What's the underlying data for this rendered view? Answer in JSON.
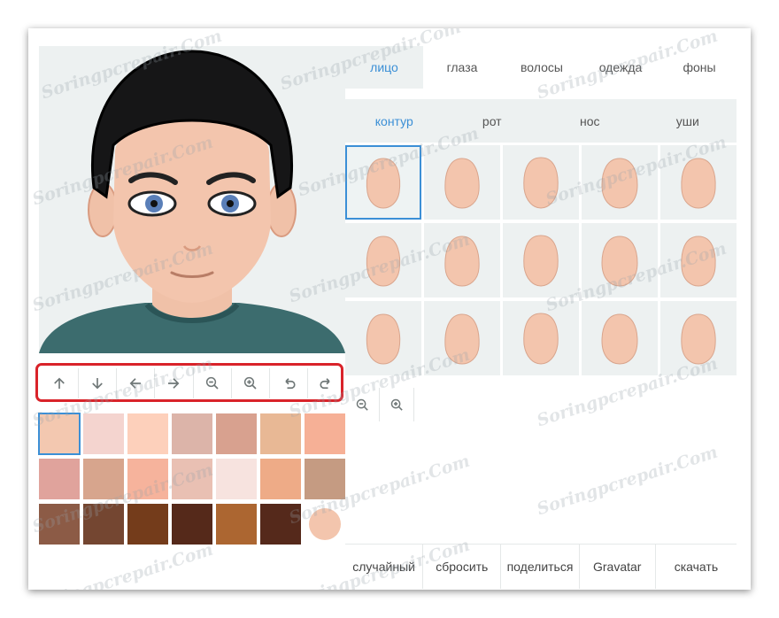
{
  "tabs": [
    {
      "label": "лицо",
      "active": true
    },
    {
      "label": "глаза",
      "active": false
    },
    {
      "label": "волосы",
      "active": false
    },
    {
      "label": "одежда",
      "active": false
    },
    {
      "label": "фоны",
      "active": false
    }
  ],
  "subtabs": [
    {
      "label": "контур",
      "active": true
    },
    {
      "label": "рот",
      "active": false
    },
    {
      "label": "нос",
      "active": false
    },
    {
      "label": "уши",
      "active": false
    }
  ],
  "toolbar": [
    {
      "icon": "arrow-up-icon",
      "action": "move-up"
    },
    {
      "icon": "arrow-down-icon",
      "action": "move-down"
    },
    {
      "icon": "arrow-left-icon",
      "action": "move-left"
    },
    {
      "icon": "arrow-right-icon",
      "action": "move-right"
    },
    {
      "icon": "zoom-out-icon",
      "action": "zoom-out"
    },
    {
      "icon": "zoom-in-icon",
      "action": "zoom-in"
    },
    {
      "icon": "undo-icon",
      "action": "undo"
    },
    {
      "icon": "redo-icon",
      "action": "redo"
    }
  ],
  "palette": [
    "#f3c8b0",
    "#f4d4cf",
    "#fdd0bb",
    "#dcb4a9",
    "#d8a18f",
    "#e8b895",
    "#f6b096",
    "#e0a39c",
    "#d7a58d",
    "#f6b39c",
    "#e9c0b3",
    "#f7e3df",
    "#eeab87",
    "#c59b82",
    "#8c5b46",
    "#744631",
    "#743c1b",
    "#55291a",
    "#ac6631",
    "#55291b",
    "#f3c5ad"
  ],
  "selected_color": "#f3c8b0",
  "face_skin_color": "#f3c5ad",
  "actions": [
    {
      "label": "случайный"
    },
    {
      "label": "сбросить"
    },
    {
      "label": "поделиться"
    },
    {
      "label": "Gravatar"
    },
    {
      "label": "скачать"
    }
  ],
  "watermark": "Soringpcrepair.Com",
  "colors": {
    "accent": "#3b8fd6",
    "highlight": "#d9232a",
    "panel": "#edf1f1"
  }
}
